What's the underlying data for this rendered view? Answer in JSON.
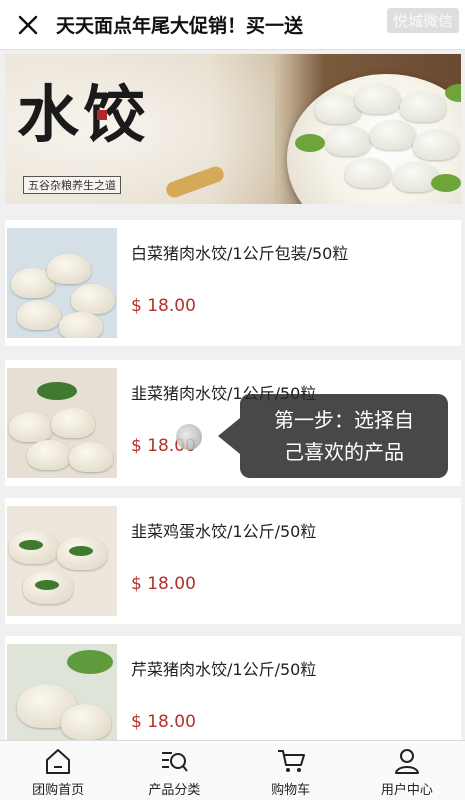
{
  "header": {
    "title": "天天面点年尾大促销！买一送",
    "watermark": "悦城微信"
  },
  "banner": {
    "headline": "水饺",
    "subtitle": "五谷杂粮养生之道"
  },
  "products": [
    {
      "name": "白菜猪肉水饺/1公斤包装/50粒",
      "price": "$ 18.00"
    },
    {
      "name": "韭菜猪肉水饺/1公斤/50粒",
      "price": "$ 18.00"
    },
    {
      "name": "韭菜鸡蛋水饺/1公斤/50粒",
      "price": "$ 18.00"
    },
    {
      "name": "芹菜猪肉水饺/1公斤/50粒",
      "price": "$ 18.00"
    }
  ],
  "tooltip": {
    "line1": "第一步：选择自",
    "line2": "己喜欢的产品"
  },
  "tabbar": {
    "items": [
      {
        "label": "团购首页",
        "icon": "home-icon"
      },
      {
        "label": "产品分类",
        "icon": "category-search-icon"
      },
      {
        "label": "购物车",
        "icon": "cart-icon"
      },
      {
        "label": "用户中心",
        "icon": "user-icon"
      }
    ]
  },
  "colors": {
    "price": "#b5302a",
    "tooltip_bg": "#282828"
  }
}
